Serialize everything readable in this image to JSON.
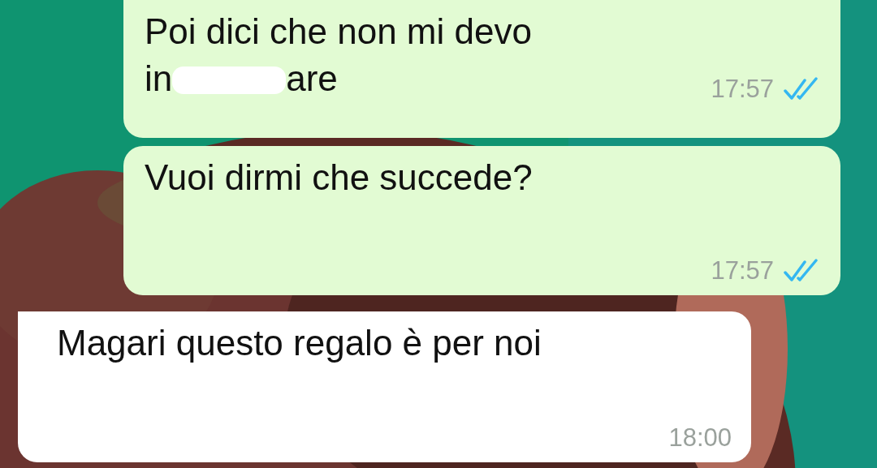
{
  "messages": [
    {
      "outgoing": true,
      "parts": [
        {
          "kind": "text",
          "text": "Poi dici che non mi devo"
        },
        {
          "kind": "break"
        },
        {
          "kind": "text",
          "text": "in"
        },
        {
          "kind": "redaction"
        },
        {
          "kind": "text",
          "text": "are"
        }
      ],
      "time": "17:57",
      "read": true
    },
    {
      "outgoing": true,
      "parts": [
        {
          "kind": "text",
          "text": "Vuoi dirmi che succede?"
        }
      ],
      "time": "17:57",
      "read": true
    },
    {
      "outgoing": false,
      "parts": [
        {
          "kind": "text",
          "text": "Magari questo regalo è per noi"
        }
      ],
      "time": "18:00"
    }
  ]
}
